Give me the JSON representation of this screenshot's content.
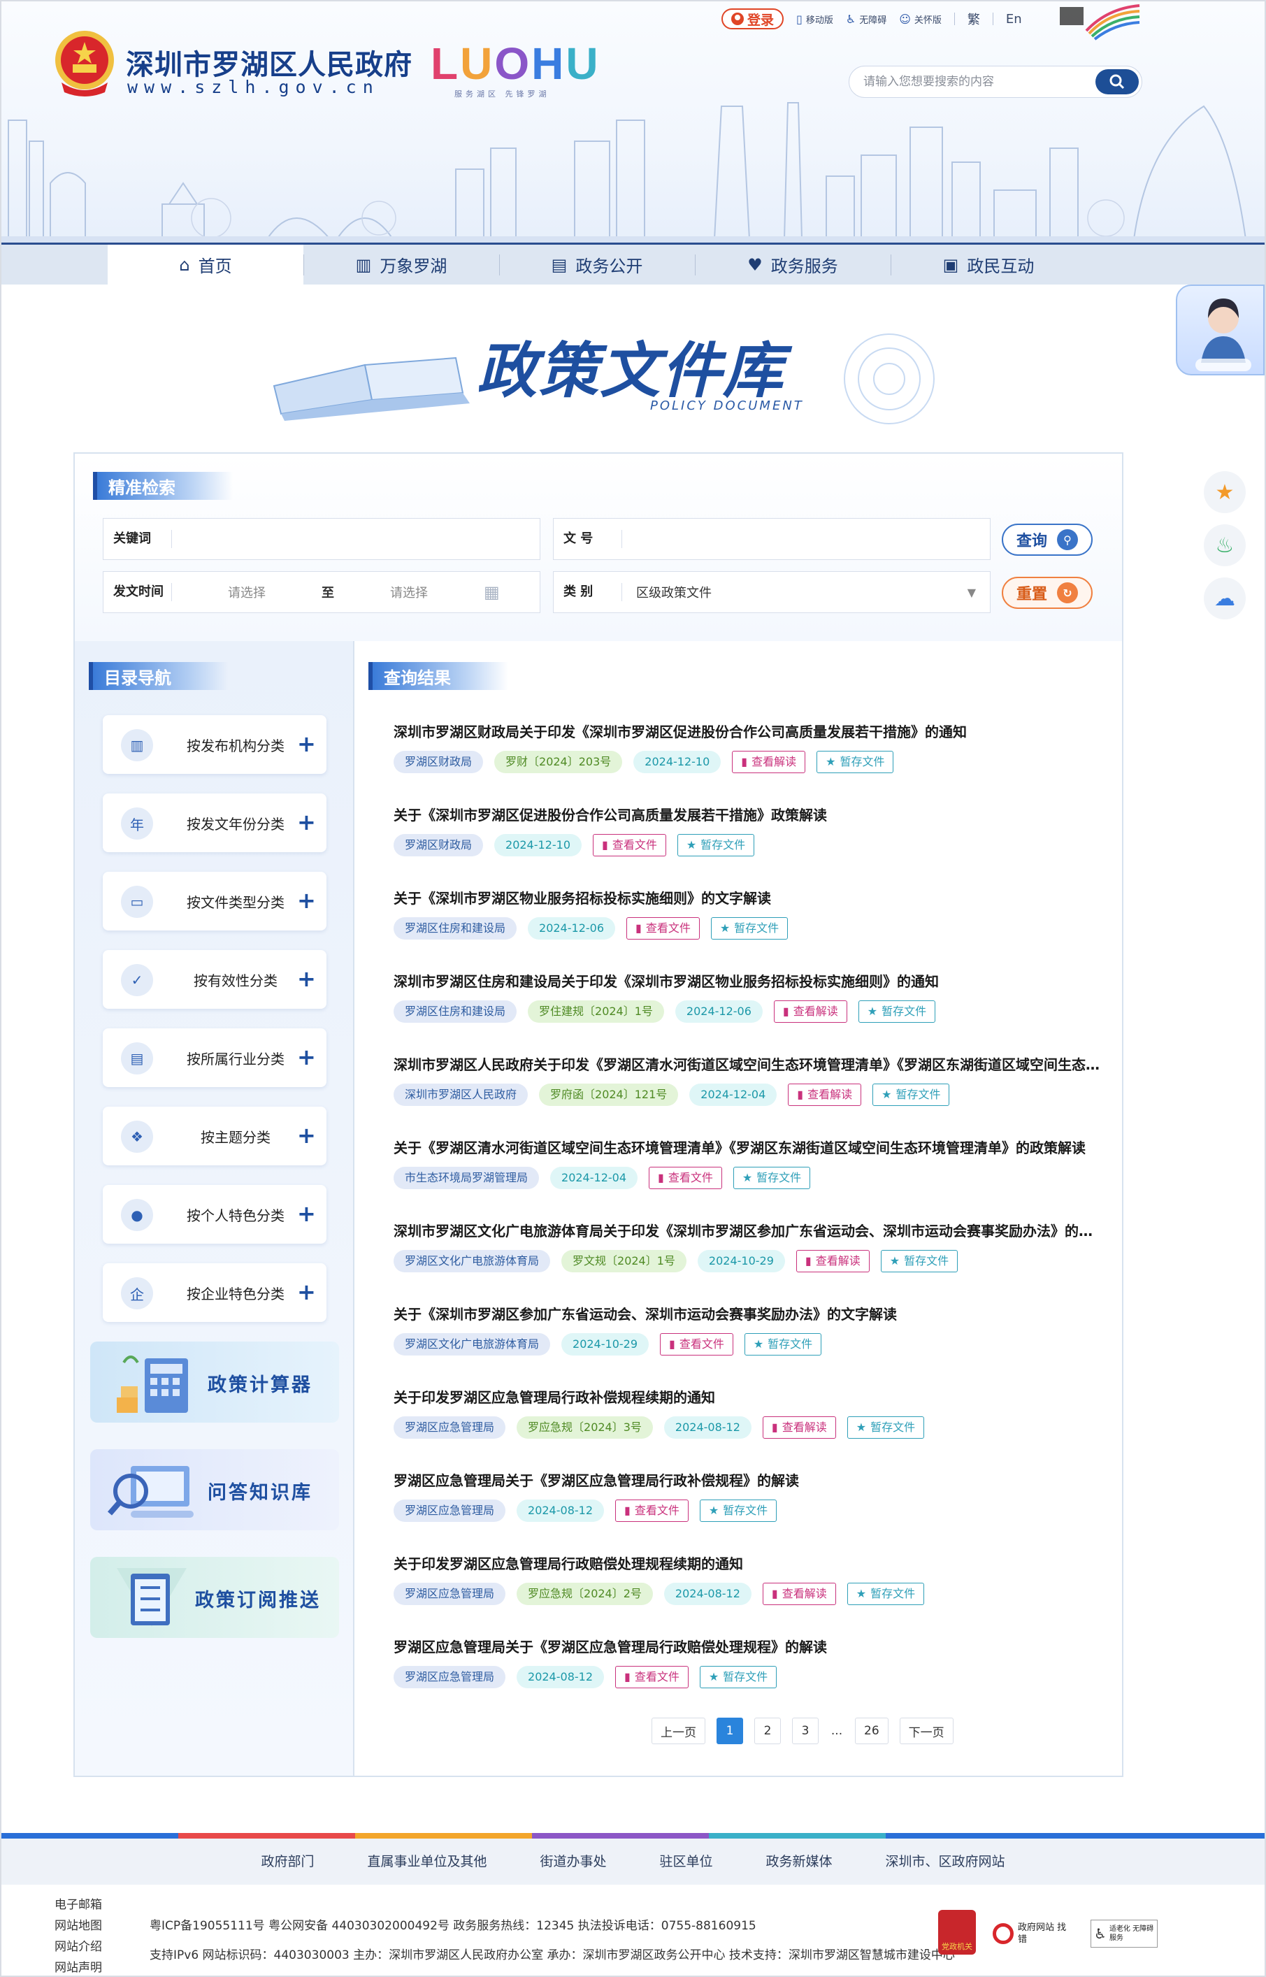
{
  "header": {
    "site_name": "深圳市罗湖区人民政府",
    "site_domain": "www.szlh.gov.cn",
    "luohu_letters": [
      "L",
      "U",
      "O",
      "H",
      "U"
    ],
    "luohu_slogan": "服务湖区  先锋罗湖",
    "login_label": "登录",
    "mobile_label": "移动版",
    "accessible_label": "无障碍",
    "elder_label": "关怀版",
    "trad_label": "繁",
    "en_label": "En",
    "search_placeholder": "请输入您想要搜索的内容"
  },
  "nav": [
    {
      "label": "首页",
      "icon": "home-icon"
    },
    {
      "label": "万象罗湖",
      "icon": "city-icon"
    },
    {
      "label": "政务公开",
      "icon": "document-icon"
    },
    {
      "label": "政务服务",
      "icon": "service-icon"
    },
    {
      "label": "政民互动",
      "icon": "chat-icon"
    }
  ],
  "hero": {
    "title": "政策文件库",
    "subtitle": "POLICY DOCUMENT"
  },
  "search_panel": {
    "title": "精准检索",
    "keyword_label": "关键词",
    "doc_no_label": "文  号",
    "date_label": "发文时间",
    "date_from_placeholder": "请选择",
    "date_to_text": "至",
    "date_to_placeholder": "请选择",
    "category_label": "类  别",
    "category_value": "区级政策文件",
    "query_label": "查询",
    "reset_label": "重置"
  },
  "sidebar": {
    "title": "目录导航",
    "categories": [
      {
        "label": "按发布机构分类",
        "icon": "building-icon"
      },
      {
        "label": "按发文年份分类",
        "icon": "year-icon"
      },
      {
        "label": "按文件类型分类",
        "icon": "folder-icon"
      },
      {
        "label": "按有效性分类",
        "icon": "validity-icon"
      },
      {
        "label": "按所属行业分类",
        "icon": "industry-icon"
      },
      {
        "label": "按主题分类",
        "icon": "topic-icon"
      },
      {
        "label": "按个人特色分类",
        "icon": "person-icon"
      },
      {
        "label": "按企业特色分类",
        "icon": "enterprise-icon"
      }
    ],
    "promos": [
      "政策计算器",
      "问答知识库",
      "政策订阅推送"
    ]
  },
  "results": {
    "title": "查询结果",
    "read_label": "查看解读",
    "view_label": "查看文件",
    "save_label": "暂存文件",
    "items": [
      {
        "title": "深圳市罗湖区财政局关于印发《深圳市罗湖区促进股份合作公司高质量发展若干措施》的通知",
        "org": "罗湖区财政局",
        "doc_no": "罗财〔2024〕203号",
        "date": "2024-12-10",
        "action": "read"
      },
      {
        "title": "关于《深圳市罗湖区促进股份合作公司高质量发展若干措施》政策解读",
        "org": "罗湖区财政局",
        "doc_no": "",
        "date": "2024-12-10",
        "action": "view"
      },
      {
        "title": "关于《深圳市罗湖区物业服务招标投标实施细则》的文字解读",
        "org": "罗湖区住房和建设局",
        "doc_no": "",
        "date": "2024-12-06",
        "action": "view"
      },
      {
        "title": "深圳市罗湖区住房和建设局关于印发《深圳市罗湖区物业服务招标投标实施细则》的通知",
        "org": "罗湖区住房和建设局",
        "doc_no": "罗住建规〔2024〕1号",
        "date": "2024-12-06",
        "action": "read"
      },
      {
        "title": "深圳市罗湖区人民政府关于印发《罗湖区清水河街道区域空间生态环境管理清单》《罗湖区东湖街道区域空间生态环境管理清单》的通知",
        "org": "深圳市罗湖区人民政府",
        "doc_no": "罗府函〔2024〕121号",
        "date": "2024-12-04",
        "action": "read"
      },
      {
        "title": "关于《罗湖区清水河街道区域空间生态环境管理清单》《罗湖区东湖街道区域空间生态环境管理清单》的政策解读",
        "org": "市生态环境局罗湖管理局",
        "doc_no": "",
        "date": "2024-12-04",
        "action": "view"
      },
      {
        "title": "深圳市罗湖区文化广电旅游体育局关于印发《深圳市罗湖区参加广东省运动会、深圳市运动会赛事奖励办法》的通知",
        "org": "罗湖区文化广电旅游体育局",
        "doc_no": "罗文规〔2024〕1号",
        "date": "2024-10-29",
        "action": "read"
      },
      {
        "title": "关于《深圳市罗湖区参加广东省运动会、深圳市运动会赛事奖励办法》的文字解读",
        "org": "罗湖区文化广电旅游体育局",
        "doc_no": "",
        "date": "2024-10-29",
        "action": "view"
      },
      {
        "title": "关于印发罗湖区应急管理局行政补偿规程续期的通知",
        "org": "罗湖区应急管理局",
        "doc_no": "罗应急规〔2024〕3号",
        "date": "2024-08-12",
        "action": "read"
      },
      {
        "title": "罗湖区应急管理局关于《罗湖区应急管理局行政补偿规程》的解读",
        "org": "罗湖区应急管理局",
        "doc_no": "",
        "date": "2024-08-12",
        "action": "view"
      },
      {
        "title": "关于印发罗湖区应急管理局行政赔偿处理规程续期的通知",
        "org": "罗湖区应急管理局",
        "doc_no": "罗应急规〔2024〕2号",
        "date": "2024-08-12",
        "action": "read"
      },
      {
        "title": "罗湖区应急管理局关于《罗湖区应急管理局行政赔偿处理规程》的解读",
        "org": "罗湖区应急管理局",
        "doc_no": "",
        "date": "2024-08-12",
        "action": "view"
      }
    ]
  },
  "pagination": {
    "prev": "上一页",
    "pages": [
      "1",
      "2",
      "3",
      "...",
      "26"
    ],
    "current": "1",
    "next": "下一页"
  },
  "footer": {
    "links": [
      "政府部门",
      "直属事业单位及其他",
      "街道办事处",
      "驻区单位",
      "政务新媒体",
      "深圳市、区政府网站"
    ],
    "left_links": [
      "电子邮箱",
      "网站地图",
      "网站介绍",
      "网站声明"
    ],
    "line1": "粤ICP备19055111号  粤公网安备 44030302000492号  政务服务热线：12345  执法投诉电话：0755-88160915",
    "line2": "支持IPv6  网站标识码：4403030003  主办：深圳市罗湖区人民政府办公室  承办：深圳市罗湖区政务公开中心  技术支持：深圳市罗湖区智慧城市建设中心",
    "badge_gov": "党政机关",
    "badge_error": "政府网站 找错",
    "badge_elder": "适老化 无障碍服务"
  }
}
